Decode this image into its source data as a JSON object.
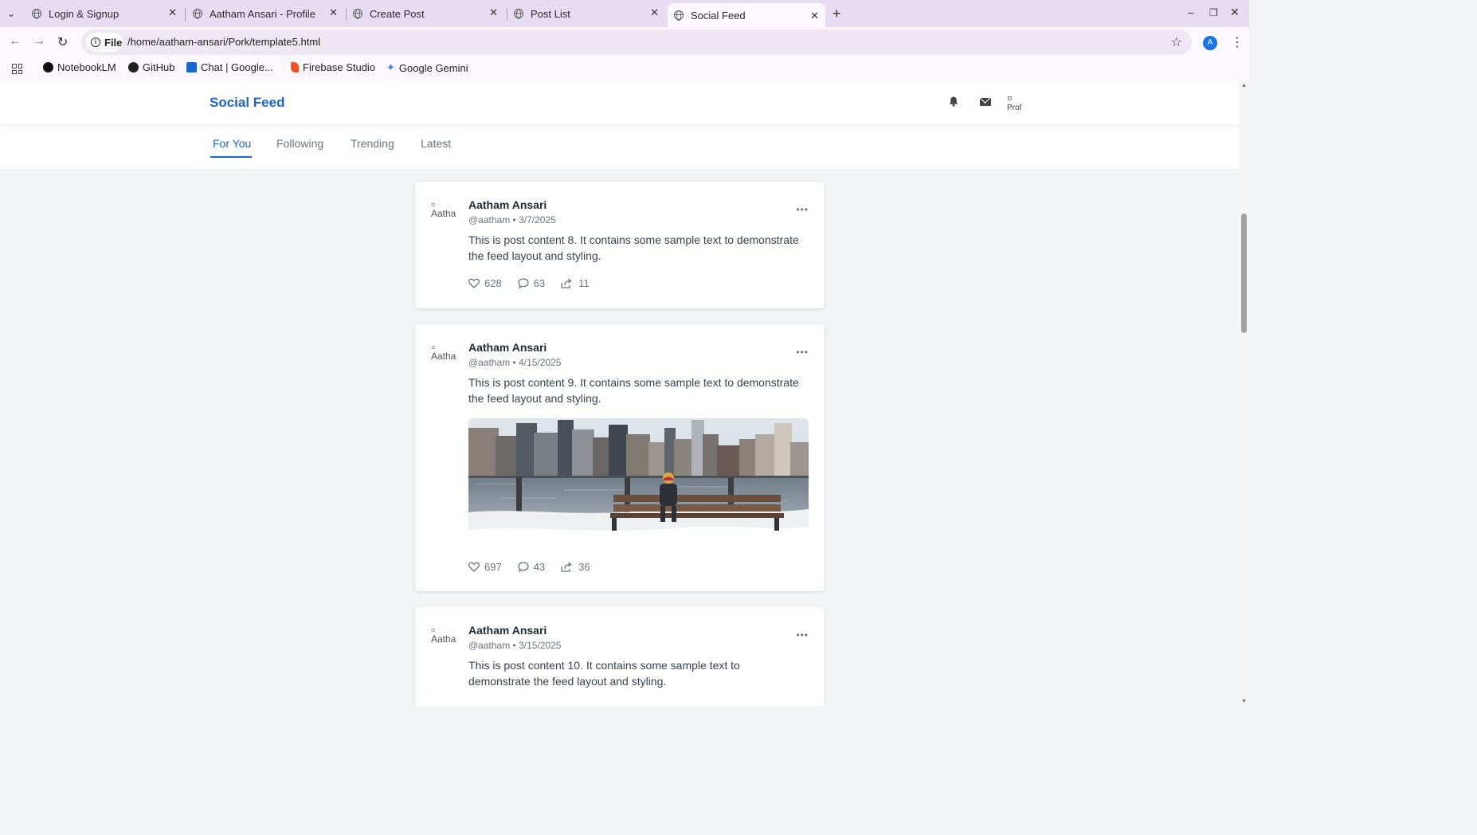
{
  "browser": {
    "tabs": [
      {
        "title": "Login & Signup"
      },
      {
        "title": "Aatham Ansari - Profile"
      },
      {
        "title": "Create Post"
      },
      {
        "title": "Post List"
      },
      {
        "title": "Social Feed"
      }
    ],
    "active_tab": "Social Feed",
    "chip_label": "File",
    "url": "/home/aatham-ansari/Pork/template5.html",
    "profile_initial": "A",
    "bookmarks": [
      {
        "label": "NotebookLM",
        "icon": "notebooklm-icon"
      },
      {
        "label": "GitHub",
        "icon": "github-icon"
      },
      {
        "label": "Chat | Google...",
        "icon": "chat-icon"
      },
      {
        "label": "Firebase Studio",
        "icon": "firebase-icon"
      },
      {
        "label": "Google Gemini",
        "icon": "gemini-icon"
      }
    ]
  },
  "app": {
    "brand": "Social Feed",
    "header_avatar_alt": "Prof",
    "feed_tabs": [
      "For You",
      "Following",
      "Trending",
      "Latest"
    ],
    "active_feed_tab": "For You"
  },
  "posts": [
    {
      "author": "Aatham Ansari",
      "avatar_alt": "Aatha",
      "meta": "@aatham • 3/7/2025",
      "content": "This is post content 8. It contains some sample text to demonstrate the feed layout and styling.",
      "likes": "628",
      "comments": "63",
      "shares": "11",
      "has_image": false
    },
    {
      "author": "Aatham Ansari",
      "avatar_alt": "Aatha",
      "meta": "@aatham • 4/15/2025",
      "content": "This is post content 9. It contains some sample text to demonstrate the feed layout and styling.",
      "likes": "697",
      "comments": "43",
      "shares": "36",
      "has_image": true
    },
    {
      "author": "Aatham Ansari",
      "avatar_alt": "Aatha",
      "meta": "@aatham • 3/15/2025",
      "content": "This is post content 10. It contains some sample text to demonstrate the feed layout and styling.",
      "has_image": false
    }
  ],
  "colors": {
    "accent": "#1b66c9",
    "page_bg": "#f3f4f6",
    "tabstrip_bg": "#e7dcf1"
  }
}
